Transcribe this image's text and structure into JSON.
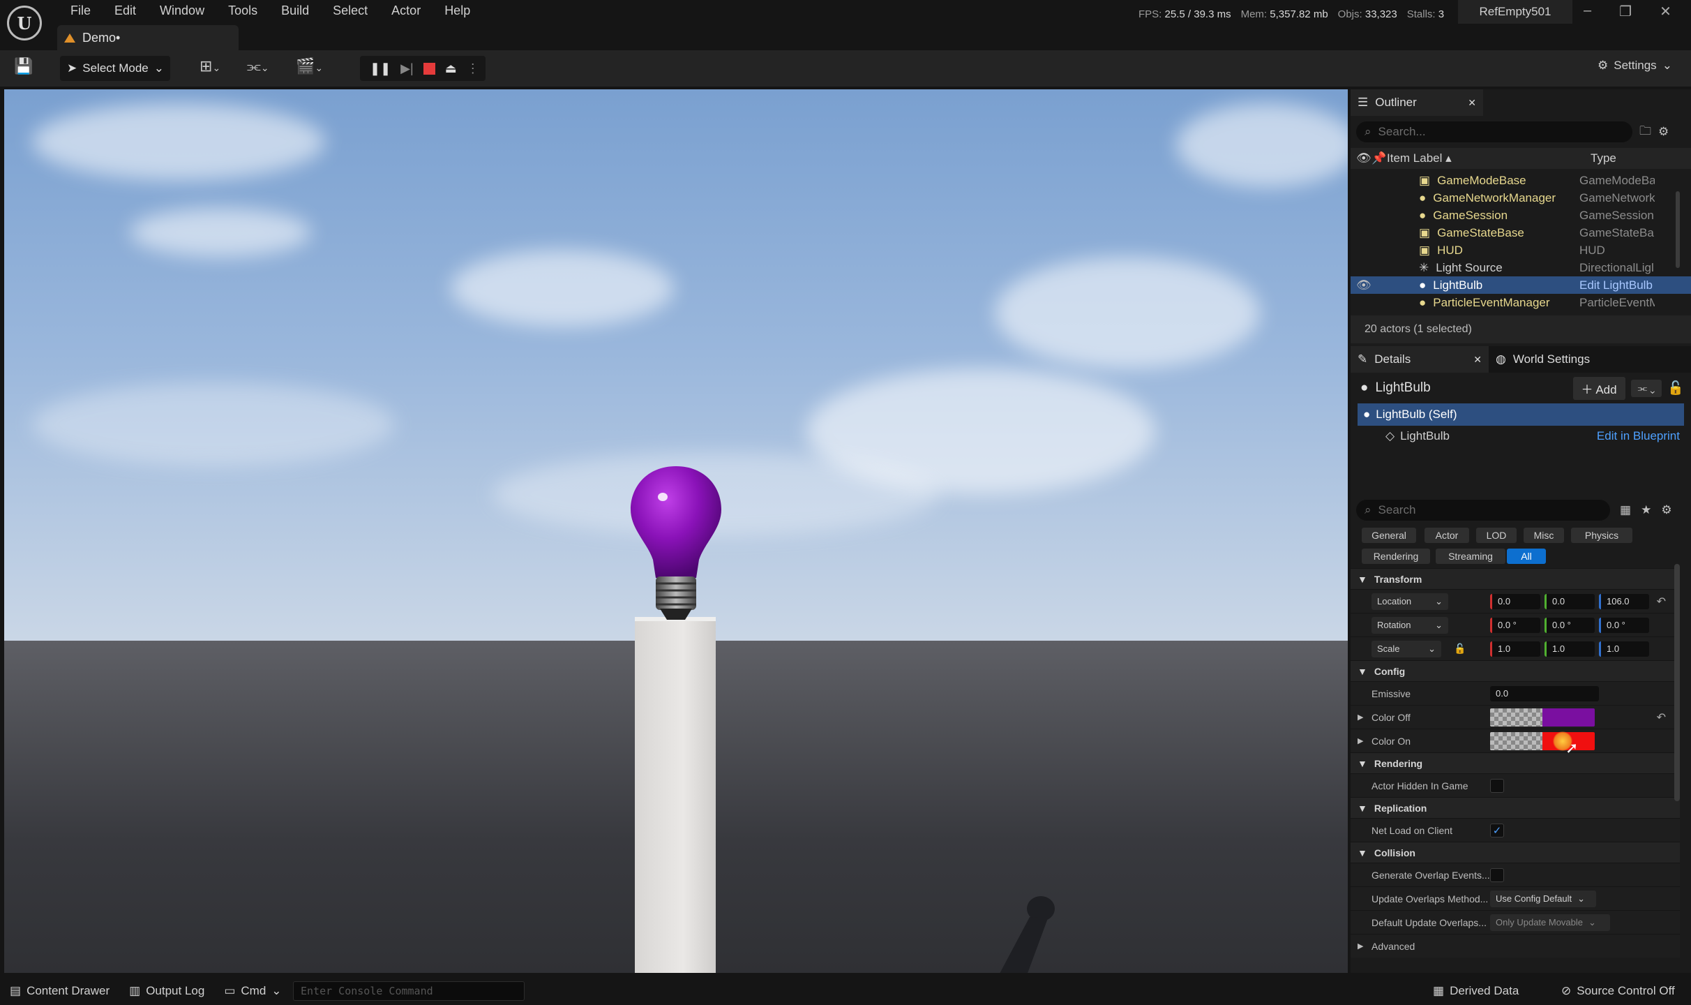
{
  "menu": [
    "File",
    "Edit",
    "Window",
    "Tools",
    "Build",
    "Select",
    "Actor",
    "Help"
  ],
  "level_tab": "Demo•",
  "stats": {
    "fps_label": "FPS:",
    "fps": "25.5",
    "ms": "/ 39.3 ms",
    "mem_label": "Mem:",
    "mem": "5,357.82 mb",
    "objs_label": "Objs:",
    "objs": "33,323",
    "stalls_label": "Stalls:",
    "stalls": "3"
  },
  "project_name": "RefEmpty501",
  "toolbar": {
    "select_mode": "Select Mode",
    "settings": "Settings"
  },
  "outliner": {
    "title": "Outliner",
    "search_placeholder": "Search...",
    "col_label": "Item Label ▴",
    "col_type": "Type",
    "rows": [
      {
        "label": "GameModeBase",
        "type": "GameModeBa"
      },
      {
        "label": "GameNetworkManager",
        "type": "GameNetwork"
      },
      {
        "label": "GameSession",
        "type": "GameSession"
      },
      {
        "label": "GameStateBase",
        "type": "GameStateBa"
      },
      {
        "label": "HUD",
        "type": "HUD"
      },
      {
        "label": "Light Source",
        "type": "DirectionalLigl"
      },
      {
        "label": "LightBulb",
        "type": "Edit LightBulb"
      },
      {
        "label": "ParticleEventManager",
        "type": "ParticleEventM"
      }
    ],
    "count": "20 actors (1 selected)"
  },
  "details": {
    "tab": "Details",
    "world_tab": "World Settings",
    "actor": "LightBulb",
    "add": "Add",
    "self_row": "LightBulb (Self)",
    "component": "LightBulb",
    "edit_bp": "Edit in Blueprint",
    "search_placeholder": "Search",
    "categories": [
      "General",
      "Actor",
      "LOD",
      "Misc",
      "Physics",
      "Rendering",
      "Streaming",
      "All"
    ],
    "transform": {
      "title": "Transform",
      "location": {
        "label": "Location",
        "x": "0.0",
        "y": "0.0",
        "z": "106.0"
      },
      "rotation": {
        "label": "Rotation",
        "x": "0.0 °",
        "y": "0.0 °",
        "z": "0.0 °"
      },
      "scale": {
        "label": "Scale",
        "x": "1.0",
        "y": "1.0",
        "z": "1.0"
      }
    },
    "config": {
      "title": "Config",
      "emissive_label": "Emissive",
      "emissive": "0.0",
      "color_off": "Color Off",
      "color_on": "Color On",
      "color_off_hex": "#7a0fa0",
      "color_on_hex": "#f01010"
    },
    "rendering": {
      "title": "Rendering",
      "hidden": "Actor Hidden In Game"
    },
    "replication": {
      "title": "Replication",
      "net_load": "Net Load on Client"
    },
    "collision": {
      "title": "Collision",
      "gen_overlap": "Generate Overlap Events...",
      "update_method": "Update Overlaps Method...",
      "update_method_val": "Use Config Default",
      "default_update": "Default Update Overlaps...",
      "default_update_val": "Only Update Movable"
    },
    "advanced": "Advanced"
  },
  "status": {
    "content_drawer": "Content Drawer",
    "output_log": "Output Log",
    "cmd": "Cmd",
    "console_placeholder": "Enter Console Command",
    "derived": "Derived Data",
    "source_control": "Source Control Off"
  },
  "colors": {
    "accent": "#0d6fcf",
    "selection": "#2d4f80",
    "bulb": "#8a12b8"
  }
}
